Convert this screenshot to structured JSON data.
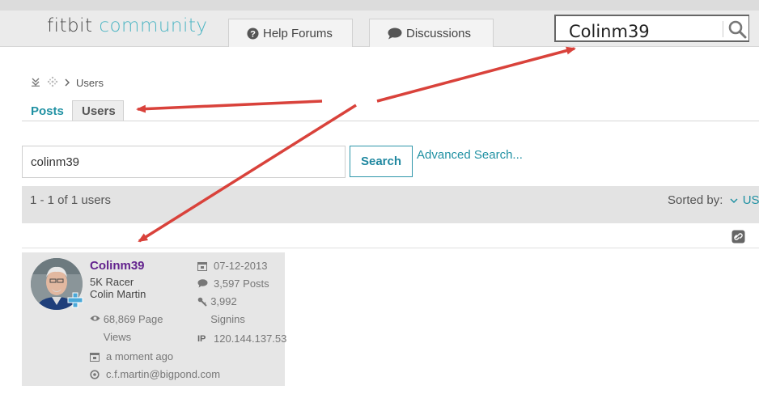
{
  "header": {
    "logo_brand": "fitbit",
    "logo_community": "community",
    "tabs": [
      {
        "label": "Help Forums",
        "icon": "question-circle-icon"
      },
      {
        "label": "Discussions",
        "icon": "speech-bubble-icon"
      }
    ],
    "search_value": "Colinm39"
  },
  "breadcrumb": {
    "current": "Users"
  },
  "subtabs": {
    "posts": "Posts",
    "users": "Users"
  },
  "user_search": {
    "value": "colinm39",
    "button": "Search",
    "advanced_link": "Advanced Search..."
  },
  "results": {
    "count_text": "1 - 1 of 1 users",
    "sorted_label": "Sorted by:",
    "sorted_value": "USE"
  },
  "user": {
    "name": "Colinm39",
    "rank": "5K Racer",
    "real_name": "Colin Martin",
    "page_views": "68,869 Page Views",
    "last_visit": "a moment ago",
    "email": "c.f.martin@bigpond.com",
    "registered": "07-12-2013",
    "posts": "3,597 Posts",
    "signins": "3,992 Signins",
    "ip": "120.144.137.53"
  },
  "colors": {
    "accent": "#2091a3",
    "username": "#63238e",
    "annotation_arrow": "#d9423b"
  }
}
